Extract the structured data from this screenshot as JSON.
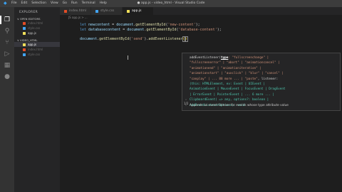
{
  "titlebar": {
    "menu": [
      "File",
      "Edit",
      "Selection",
      "View",
      "Go",
      "Run",
      "Terminal",
      "Help"
    ],
    "window_title": "● app.js - video_html - Visual Studio Code"
  },
  "sidebar": {
    "title": "EXPLORER",
    "open_editors_label": "∨ OPEN EDITORS",
    "open_editors": [
      "index.html",
      "style.css",
      "app.js"
    ],
    "folder_label": "∨ VIDEO_HTML",
    "files": [
      "app.js",
      "index.html",
      "style.css"
    ]
  },
  "tabs": [
    {
      "label": "index.html",
      "active": false
    },
    {
      "label": "style.css",
      "active": false
    },
    {
      "label": "app.js",
      "active": true
    }
  ],
  "breadcrumb": "JS app.js > ...",
  "editor": {
    "line1": {
      "kw": "let",
      "var": "newcontent",
      "eq": " = ",
      "obj": "document",
      "dot": ".",
      "fn": "getElementById",
      "open": "(",
      "str": "'new-content'",
      "close": ");"
    },
    "line2": {
      "kw": "let",
      "var": "databasecontent",
      "eq": " = ",
      "obj": "document",
      "dot": ".",
      "fn": "getElementById",
      "open": "(",
      "str": "'database-content'",
      "close": ");"
    },
    "line4": {
      "obj": "document",
      "dot1": ".",
      "fn1": "getElementById",
      "open1": "(",
      "str": "'send'",
      "close1": ")",
      "dot2": ".",
      "fn2": "addEventListener",
      "open2": "(",
      "close2": ")"
    }
  },
  "hover": {
    "sig_start": "addEventListener(",
    "sig_param": "type",
    "sig_l1_rest": ": \"fullscreenchange\" |",
    "sig_l2": "\"fullscreenerror\" | \"abort\" | \"animationcancel\" |",
    "sig_l3": "\"animationend\" | \"animationiteration\" |",
    "sig_l4": "\"animationstart\" | \"auxclick\" | \"blur\" | \"cancel\" |",
    "sig_l5a": "\"canplay\" | ... 88 more ... | \"paste\"",
    "sig_l5b": ", listener:",
    "sig_l6": "(this: HTMLElement, ev: Event | UIEvent |",
    "sig_l7": "AnimationEvent | MouseEvent | FocusEvent | DragEvent",
    "sig_l8": "| ErrorEvent | PointerEvent | ... 6 more ... |",
    "sig_l9": "ClipboardEvent) => any, options?: boolean |",
    "sig_l10": "AddEventListenerOptions): void",
    "counter": "1/2",
    "doc": "Appends an event listener for events whose type attribute value"
  },
  "colors": {
    "accent": "#007acc",
    "js_icon": "#f1e05a",
    "html_icon": "#e44d26",
    "css_icon": "#42a5f5"
  },
  "icons": [
    "explorer-icon",
    "search-icon",
    "source-control-icon",
    "run-debug-icon",
    "extensions-icon",
    "remote-icon"
  ]
}
